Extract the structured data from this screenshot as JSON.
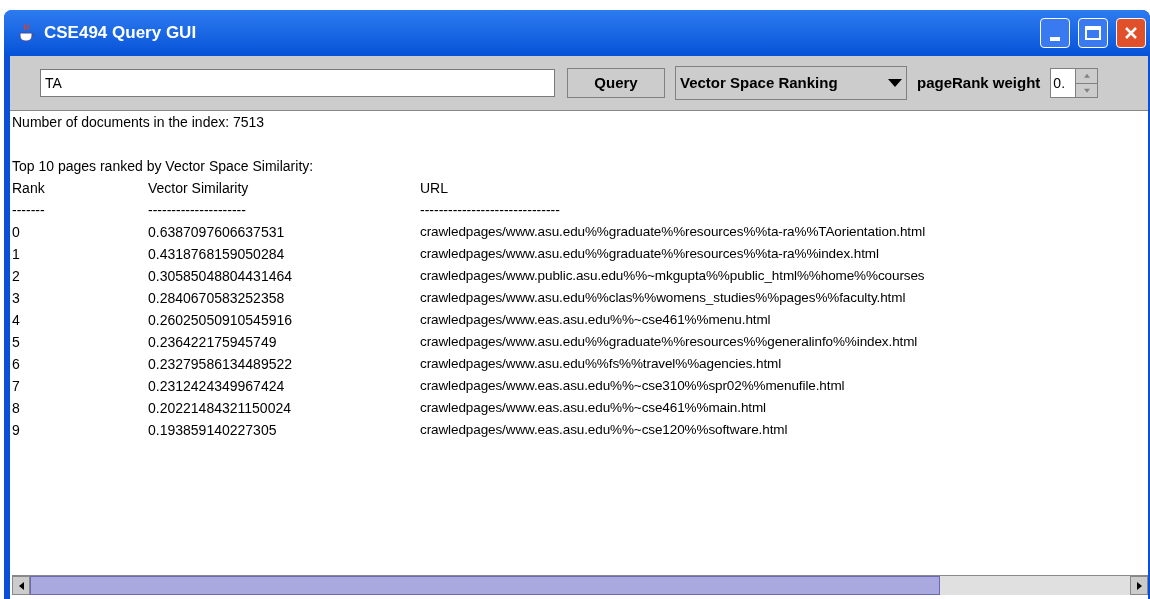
{
  "window": {
    "title": "CSE494 Query GUI"
  },
  "toolbar": {
    "query": {
      "value": "TA"
    },
    "query_button": "Query",
    "ranking_dropdown": {
      "value": "Vector Space Ranking"
    },
    "weight_label": "pageRank weight",
    "weight_spinner": {
      "value": "0."
    }
  },
  "results": {
    "summary": "Number of documents in the index: 7513",
    "heading": "Top 10 pages ranked by Vector Space Similarity:",
    "columns": [
      "Rank",
      "Vector Similarity",
      "URL"
    ],
    "rules": [
      "-------",
      "---------------------",
      "------------------------------"
    ],
    "rows": [
      {
        "rank": "0",
        "similarity": "0.6387097606637531",
        "url": "crawledpages/www.asu.edu%%graduate%%resources%%ta-ra%%TAorientation.html"
      },
      {
        "rank": "1",
        "similarity": "0.4318768159050284",
        "url": "crawledpages/www.asu.edu%%graduate%%resources%%ta-ra%%index.html"
      },
      {
        "rank": "2",
        "similarity": "0.30585048804431464",
        "url": "crawledpages/www.public.asu.edu%%~mkgupta%%public_html%%home%%courses"
      },
      {
        "rank": "3",
        "similarity": "0.2840670583252358",
        "url": "crawledpages/www.asu.edu%%clas%%womens_studies%%pages%%faculty.html"
      },
      {
        "rank": "4",
        "similarity": "0.26025050910545916",
        "url": "crawledpages/www.eas.asu.edu%%~cse461%%menu.html"
      },
      {
        "rank": "5",
        "similarity": "0.236422175945749",
        "url": "crawledpages/www.asu.edu%%graduate%%resources%%generalinfo%%index.html"
      },
      {
        "rank": "6",
        "similarity": "0.23279586134489522",
        "url": "crawledpages/www.asu.edu%%fs%%travel%%agencies.html"
      },
      {
        "rank": "7",
        "similarity": "0.2312424349967424",
        "url": "crawledpages/www.eas.asu.edu%%~cse310%%spr02%%menufile.html"
      },
      {
        "rank": "8",
        "similarity": "0.20221484321150024",
        "url": "crawledpages/www.eas.asu.edu%%~cse461%%main.html"
      },
      {
        "rank": "9",
        "similarity": "0.193859140227305",
        "url": "crawledpages/www.eas.asu.edu%%~cse120%%software.html"
      }
    ]
  }
}
